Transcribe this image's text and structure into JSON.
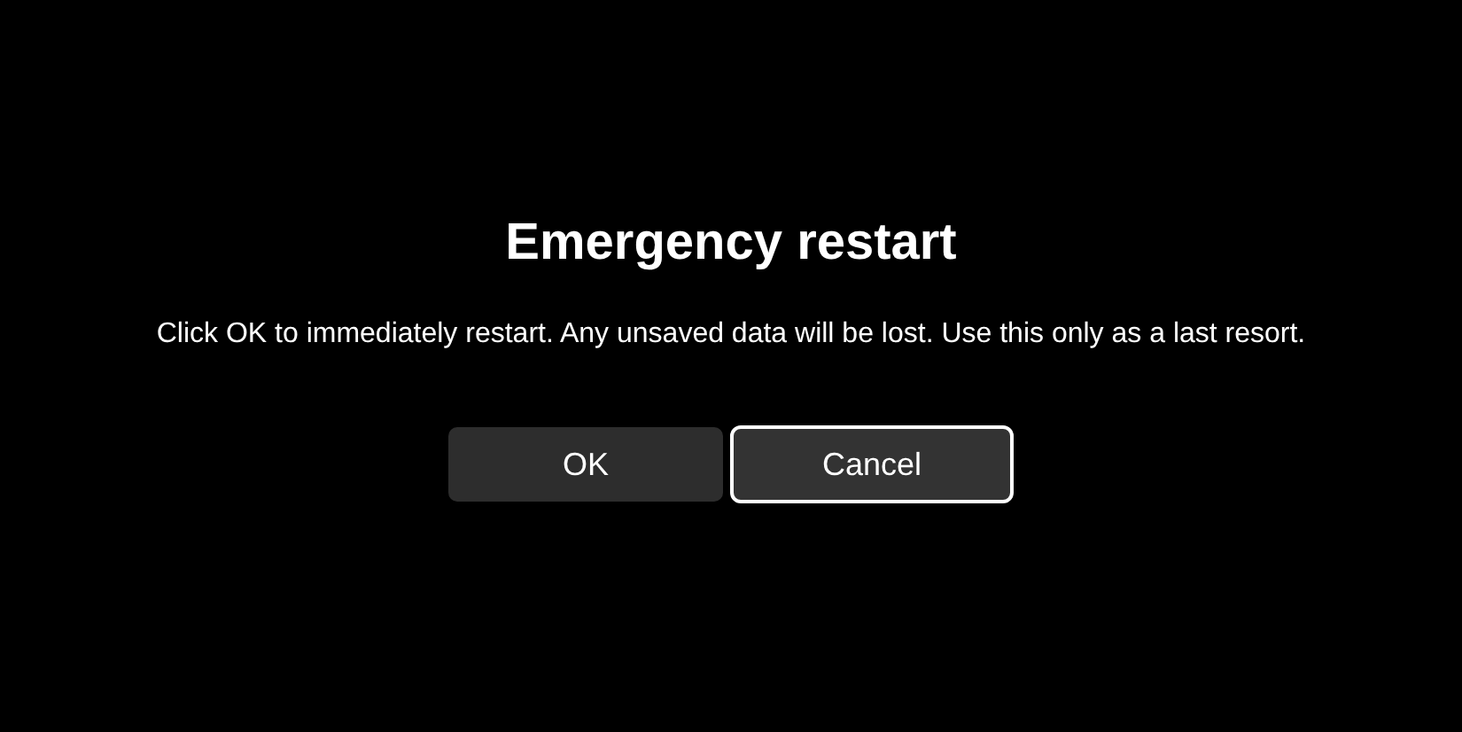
{
  "dialog": {
    "title": "Emergency restart",
    "message": "Click OK to immediately restart. Any unsaved data will be lost. Use this only as a last resort.",
    "buttons": [
      {
        "label": "OK",
        "focused": false
      },
      {
        "label": "Cancel",
        "focused": true
      }
    ]
  }
}
